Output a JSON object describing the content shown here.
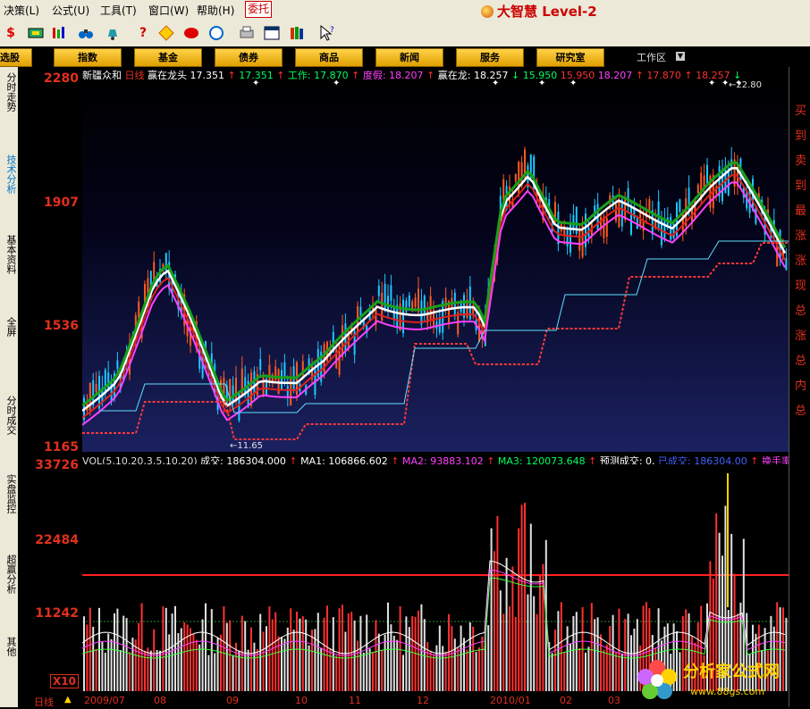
{
  "menubar": {
    "items": [
      "决策(L)",
      "公式(U)",
      "工具(T)",
      "窗口(W)",
      "帮助(H)"
    ],
    "active_item": "委托",
    "brand": "大智慧 Level-2"
  },
  "toolbar": {
    "icons": [
      "dollar-icon",
      "grid-icon",
      "bars-icon",
      "binoculars-icon",
      "bell-icon",
      "help-icon",
      "diamond-icon",
      "shape-icon",
      "circle-icon",
      "print-icon",
      "window-icon",
      "books-icon",
      "cursor-help-icon"
    ]
  },
  "navbar": {
    "buttons": [
      "选股",
      "指数",
      "基金",
      "债券",
      "商品",
      "新闻",
      "服务",
      "研究室"
    ],
    "workspace": "工作区"
  },
  "sidebar": {
    "tabs": [
      "分时走势",
      "技术分析",
      "基本资料",
      "全屏",
      "分时成交",
      "实盘监控",
      "超赢分析",
      "其他"
    ]
  },
  "price_axis": [
    "2280",
    "1907",
    "1536",
    "1165"
  ],
  "volume_axis": [
    "33726",
    "22484",
    "11242"
  ],
  "volume_multiplier": "X10",
  "indicator_header": {
    "name": "新疆众和",
    "period": "日线",
    "segments": [
      {
        "text": "赢在龙头",
        "color": "#ffffff"
      },
      {
        "text": "17.351",
        "color": "#ffffff"
      },
      {
        "text": "↑",
        "color": "#ff3030"
      },
      {
        "text": "17.351",
        "color": "#00ff60"
      },
      {
        "text": "↑",
        "color": "#ff3030"
      },
      {
        "text": "工作:",
        "color": "#00ff60"
      },
      {
        "text": "17.870",
        "color": "#00ff60"
      },
      {
        "text": "↑",
        "color": "#ff3030"
      },
      {
        "text": "度假:",
        "color": "#ff40ff"
      },
      {
        "text": "18.207",
        "color": "#ff40ff"
      },
      {
        "text": "↑",
        "color": "#ff3030"
      },
      {
        "text": "赢在龙:",
        "color": "#ffffff"
      },
      {
        "text": "18.257",
        "color": "#ffffff"
      },
      {
        "text": "↓",
        "color": "#00ff60"
      },
      {
        "text": "15.950",
        "color": "#00ff60"
      },
      {
        "text": "15.950",
        "color": "#ff3030"
      },
      {
        "text": "18.207",
        "color": "#ff40ff"
      },
      {
        "text": "↑",
        "color": "#ff3030"
      },
      {
        "text": "17.870",
        "color": "#ff3030"
      },
      {
        "text": "↑",
        "color": "#ff3030"
      },
      {
        "text": "18.257",
        "color": "#ff3030"
      },
      {
        "text": "↓",
        "color": "#00ff60"
      }
    ]
  },
  "volume_header": {
    "segments": [
      {
        "text": "VOL(5,10,20,3,5,10,20)",
        "color": "#dddddd"
      },
      {
        "text": "成交: 186304.000",
        "color": "#ffffff"
      },
      {
        "text": "↑",
        "color": "#ff3030"
      },
      {
        "text": "MA1: 106866.602",
        "color": "#ffffff"
      },
      {
        "text": "↑",
        "color": "#ff3030"
      },
      {
        "text": "MA2: 93883.102",
        "color": "#ff40ff"
      },
      {
        "text": "↑",
        "color": "#ff3030"
      },
      {
        "text": "MA3: 120073.648",
        "color": "#00ff60"
      },
      {
        "text": "↑",
        "color": "#ff3030"
      },
      {
        "text": "预测成交: 0,",
        "color": "#ffffff"
      },
      {
        "text": "已成交: 186304.00",
        "color": "#4060ff"
      },
      {
        "text": "↑",
        "color": "#ff3030"
      },
      {
        "text": "换手率",
        "color": "#ff40ff"
      }
    ]
  },
  "annotations": {
    "low_price": "11.65",
    "high_price": "22.80"
  },
  "date_axis": [
    "日线",
    "2009/07",
    "08",
    "09",
    "10",
    "11",
    "12",
    "2010/01",
    "02",
    "03"
  ],
  "right_panel": [
    "买",
    "到",
    "卖",
    "到",
    "最",
    "涨",
    "涨",
    "现",
    "总",
    "涨",
    "总",
    "内",
    "总"
  ],
  "watermark": {
    "title": "分析家公式网",
    "url": "www.88gs.com"
  },
  "colors": {
    "up": "#ff3030",
    "down": "#00c0ff",
    "accent": "#ffd200"
  }
}
